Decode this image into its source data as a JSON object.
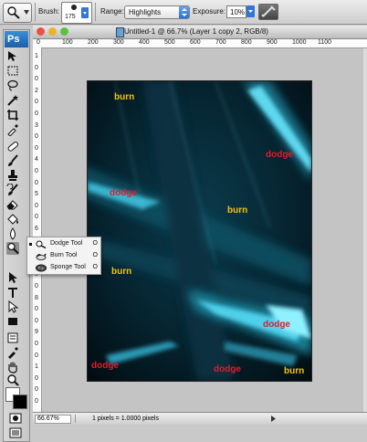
{
  "options_bar": {
    "brush_label": "Brush:",
    "brush_size": "175",
    "range_label": "Range:",
    "range_value": "Highlights",
    "exposure_label": "Exposure:",
    "exposure_value": "10%"
  },
  "window": {
    "title": "Untitled-1 @ 66.7% (Layer 1 copy 2, RGB/8)"
  },
  "ruler": {
    "top": [
      "0",
      "100",
      "200",
      "300",
      "400",
      "500",
      "600",
      "700",
      "800",
      "900",
      "1000",
      "1100"
    ],
    "left": [
      "1",
      "0",
      "0",
      "2",
      "0",
      "0",
      "3",
      "0",
      "0",
      "4",
      "0",
      "0",
      "5",
      "0",
      "0",
      "6",
      "0",
      "0",
      "7",
      "0",
      "0",
      "8",
      "0",
      "0",
      "9",
      "0",
      "0",
      "1",
      "0",
      "0",
      "0"
    ]
  },
  "toolbox": {
    "logo": "Ps"
  },
  "flyout": {
    "items": [
      {
        "label": "Dodge Tool",
        "shortcut": "O",
        "icon": "dodge-icon",
        "selected": true
      },
      {
        "label": "Burn Tool",
        "shortcut": "O",
        "icon": "burn-icon",
        "selected": false
      },
      {
        "label": "Sponge Tool",
        "shortcut": "O",
        "icon": "sponge-icon",
        "selected": false
      }
    ]
  },
  "canvas_labels": {
    "burn_1": "burn",
    "dodge_1": "dodge",
    "dodge_2": "dodge",
    "burn_2": "burn",
    "burn_3": "burn",
    "dodge_3": "dodge",
    "dodge_4": "dodge",
    "dodge_5": "dodge",
    "burn_4": "burn"
  },
  "status_bar": {
    "zoom": "66.67%",
    "doc_info": "1 pixels = 1.0000 pixels"
  },
  "colors": {
    "burn_text": "#f4c20d",
    "dodge_text": "#e01c2c",
    "canvas_bg": "#031016",
    "streak": "#29c9e6"
  }
}
